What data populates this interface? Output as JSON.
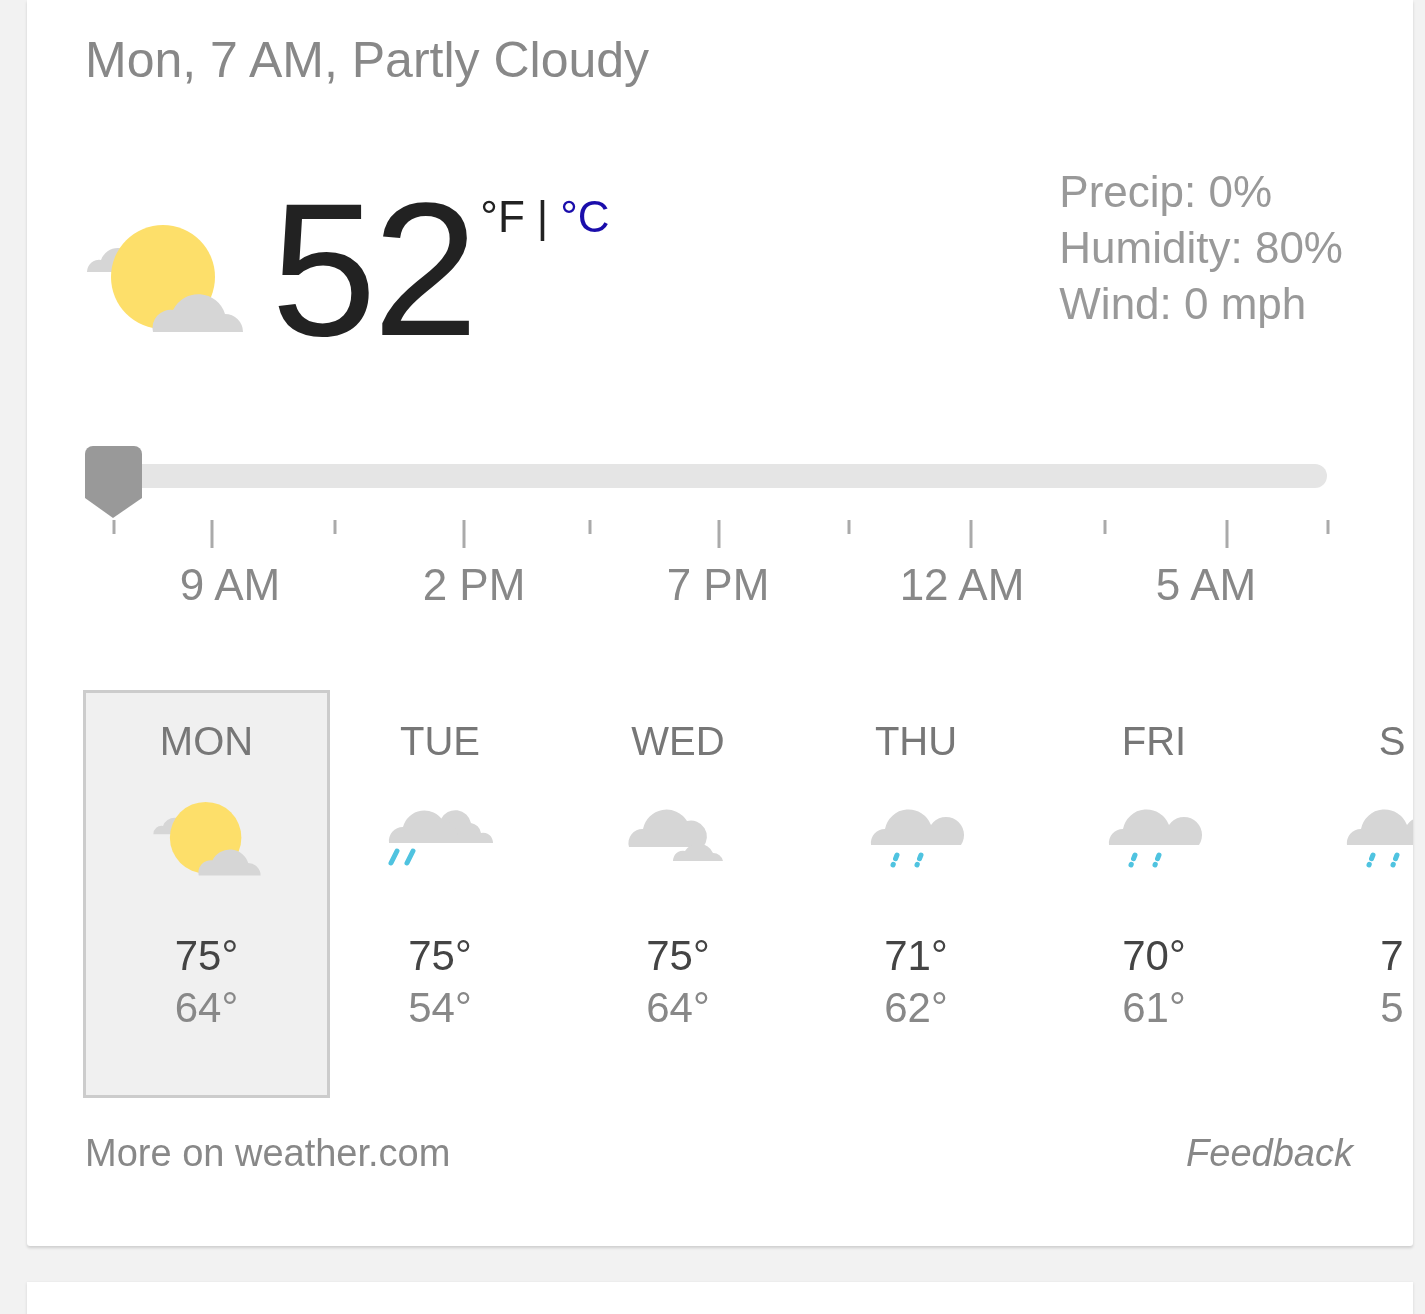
{
  "subtitle": "Mon, 7 AM, Partly Cloudy",
  "current": {
    "kind": "partly_cloudy",
    "temperature": "52",
    "units": [
      {
        "label": "°F",
        "selected": true
      },
      {
        "label": "°C",
        "selected": false
      }
    ],
    "unit_separator": "|",
    "details": [
      "Precip: 0%",
      "Humidity: 80%",
      "Wind: 0 mph"
    ]
  },
  "timeline": {
    "labels": [
      "9 AM",
      "2 PM",
      "7 PM",
      "12 AM",
      "5 AM"
    ]
  },
  "forecast": [
    {
      "day": "MON",
      "kind": "partly_cloudy",
      "high": "75°",
      "low": "64°",
      "selected": true
    },
    {
      "day": "TUE",
      "kind": "rain_partly",
      "high": "75°",
      "low": "54°",
      "selected": false
    },
    {
      "day": "WED",
      "kind": "cloudy",
      "high": "75°",
      "low": "64°",
      "selected": false
    },
    {
      "day": "THU",
      "kind": "rain",
      "high": "71°",
      "low": "62°",
      "selected": false
    },
    {
      "day": "FRI",
      "kind": "rain",
      "high": "70°",
      "low": "61°",
      "selected": false
    },
    {
      "day": "S",
      "kind": "rain",
      "high": "7",
      "low": "5",
      "selected": false
    }
  ],
  "footer": {
    "link": "More on weather.com",
    "feedback": "Feedback"
  }
}
